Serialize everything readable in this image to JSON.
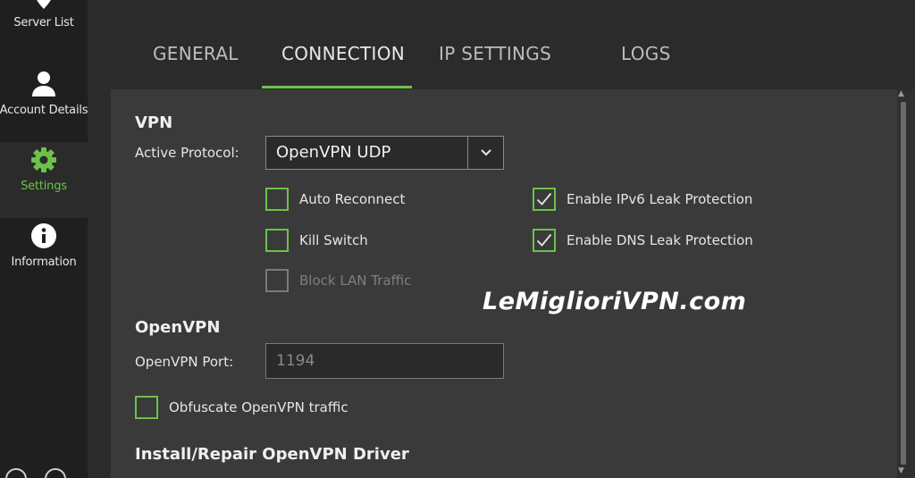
{
  "sidebar": {
    "items": [
      {
        "label": "Server List",
        "icon": "map-pin-icon"
      },
      {
        "label": "Account Details",
        "icon": "user-icon"
      },
      {
        "label": "Settings",
        "icon": "gear-icon"
      },
      {
        "label": "Information",
        "icon": "info-icon"
      }
    ],
    "active": "Settings"
  },
  "tabs": [
    {
      "label": "GENERAL"
    },
    {
      "label": "CONNECTION"
    },
    {
      "label": "IP SETTINGS"
    },
    {
      "label": "LOGS"
    }
  ],
  "active_tab": "CONNECTION",
  "vpn": {
    "title": "VPN",
    "protocol_label": "Active Protocol:",
    "protocol_value": "OpenVPN UDP",
    "options": {
      "auto_reconnect": {
        "label": "Auto Reconnect",
        "checked": false
      },
      "kill_switch": {
        "label": "Kill Switch",
        "checked": false
      },
      "block_lan": {
        "label": "Block LAN Traffic",
        "checked": false,
        "disabled": true
      },
      "ipv6_leak": {
        "label": "Enable IPv6 Leak Protection",
        "checked": true
      },
      "dns_leak": {
        "label": "Enable DNS Leak Protection",
        "checked": true
      }
    }
  },
  "openvpn": {
    "title": "OpenVPN",
    "port_label": "OpenVPN Port:",
    "port_placeholder": "1194",
    "obfuscate": {
      "label": "Obfuscate OpenVPN traffic",
      "checked": false
    }
  },
  "install": {
    "title": "Install/Repair OpenVPN Driver"
  },
  "watermark": "LeMiglioriVPN.com",
  "colors": {
    "accent": "#6cc24a",
    "sidebar_bg": "#1f1f1f",
    "panel_bg": "#3a3a3a"
  }
}
